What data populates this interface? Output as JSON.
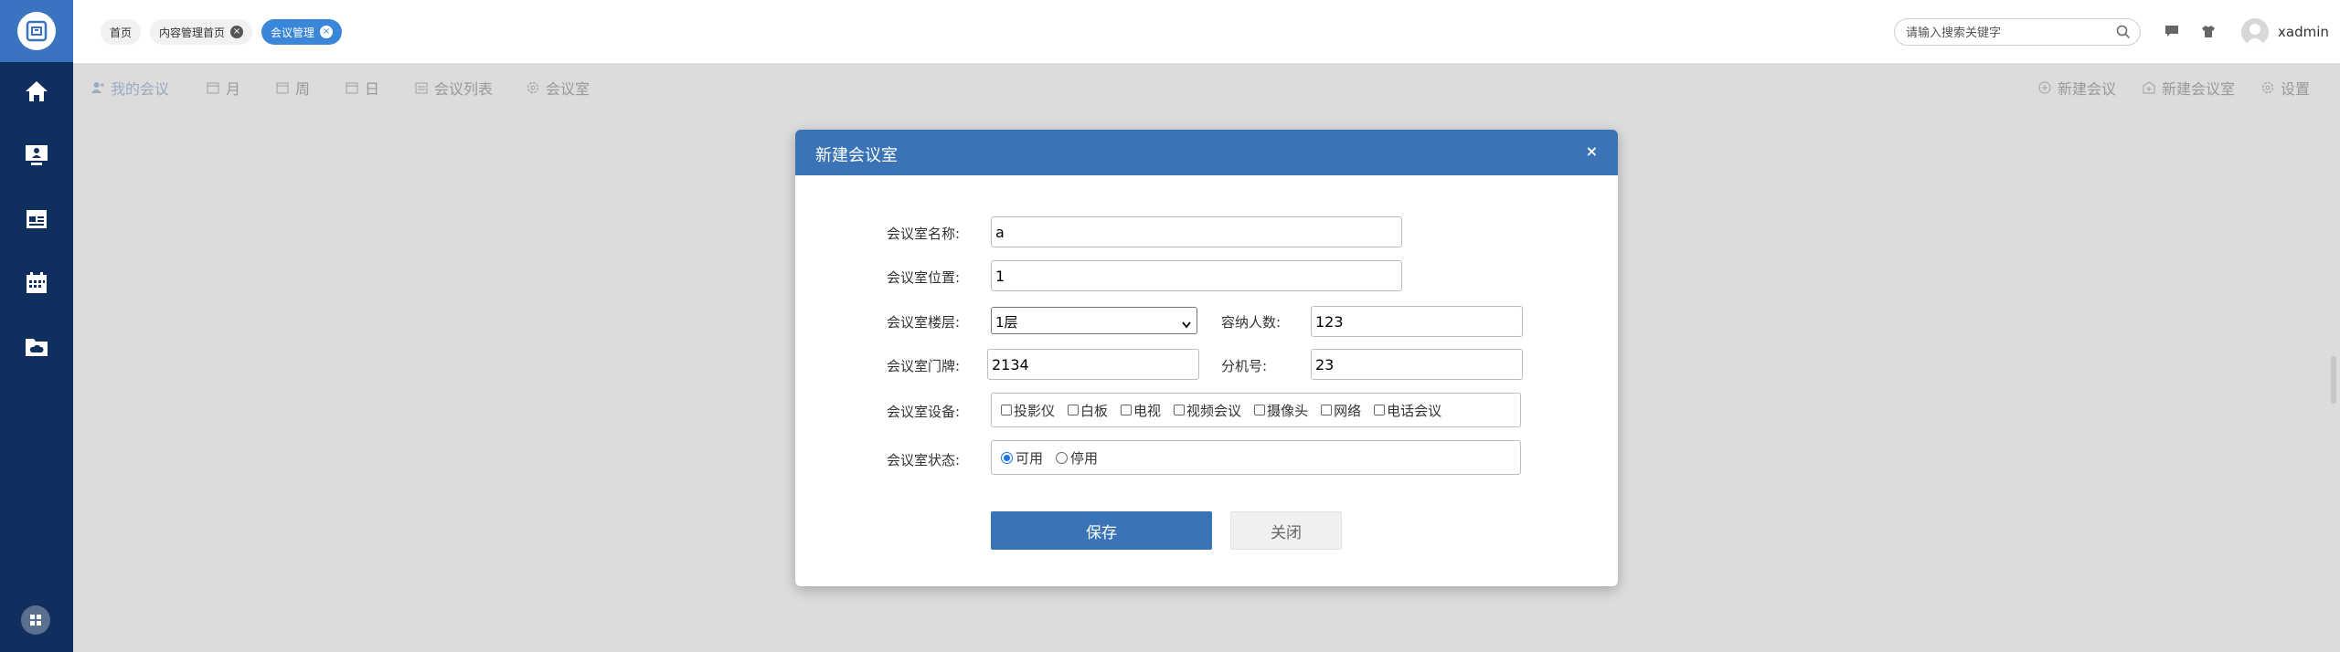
{
  "colors": {
    "sidebar": "#0f2f5f",
    "accent": "#3a74b7",
    "active_tab": "#3a86d8"
  },
  "sidebar": {
    "logo_icon": "app-logo-icon",
    "items": [
      {
        "icon": "home-icon"
      },
      {
        "icon": "monitor-user-icon"
      },
      {
        "icon": "news-icon"
      },
      {
        "icon": "calendar-icon"
      },
      {
        "icon": "cloud-folder-icon"
      }
    ],
    "bottom_icon": "grid-apps-icon"
  },
  "tabs": [
    {
      "label": "首页",
      "closable": false,
      "active": false
    },
    {
      "label": "内容管理首页",
      "closable": true,
      "active": false
    },
    {
      "label": "会议管理",
      "closable": true,
      "active": true
    }
  ],
  "search": {
    "placeholder": "请输入搜索关键字"
  },
  "user": {
    "name": "xadmin"
  },
  "nav": {
    "left": [
      {
        "label": "我的会议",
        "icon": "user-icon",
        "active": true
      },
      {
        "label": "月",
        "icon": "calendar-icon"
      },
      {
        "label": "周",
        "icon": "calendar-icon"
      },
      {
        "label": "日",
        "icon": "calendar-icon"
      },
      {
        "label": "会议列表",
        "icon": "list-icon"
      },
      {
        "label": "会议室",
        "icon": "gear-icon"
      }
    ],
    "right": [
      {
        "label": "新建会议",
        "icon": "plus-circle-icon"
      },
      {
        "label": "新建会议室",
        "icon": "building-icon"
      },
      {
        "label": "设置",
        "icon": "gear-icon"
      }
    ]
  },
  "modal": {
    "title": "新建会议室",
    "close": "×",
    "form": {
      "name_label": "会议室名称:",
      "name_value": "a",
      "location_label": "会议室位置:",
      "location_value": "1",
      "floor_label": "会议室楼层:",
      "floor_value": "1层",
      "capacity_label": "容纳人数:",
      "capacity_value": "123",
      "door_label": "会议室门牌:",
      "door_value": "2134",
      "ext_label": "分机号:",
      "ext_value": "23",
      "equipment_label": "会议室设备:",
      "equipment": [
        "投影仪",
        "白板",
        "电视",
        "视频会议",
        "摄像头",
        "网络",
        "电话会议"
      ],
      "status_label": "会议室状态:",
      "status_options": [
        {
          "label": "可用",
          "selected": true
        },
        {
          "label": "停用",
          "selected": false
        }
      ]
    },
    "save_label": "保存",
    "close_label": "关闭"
  }
}
